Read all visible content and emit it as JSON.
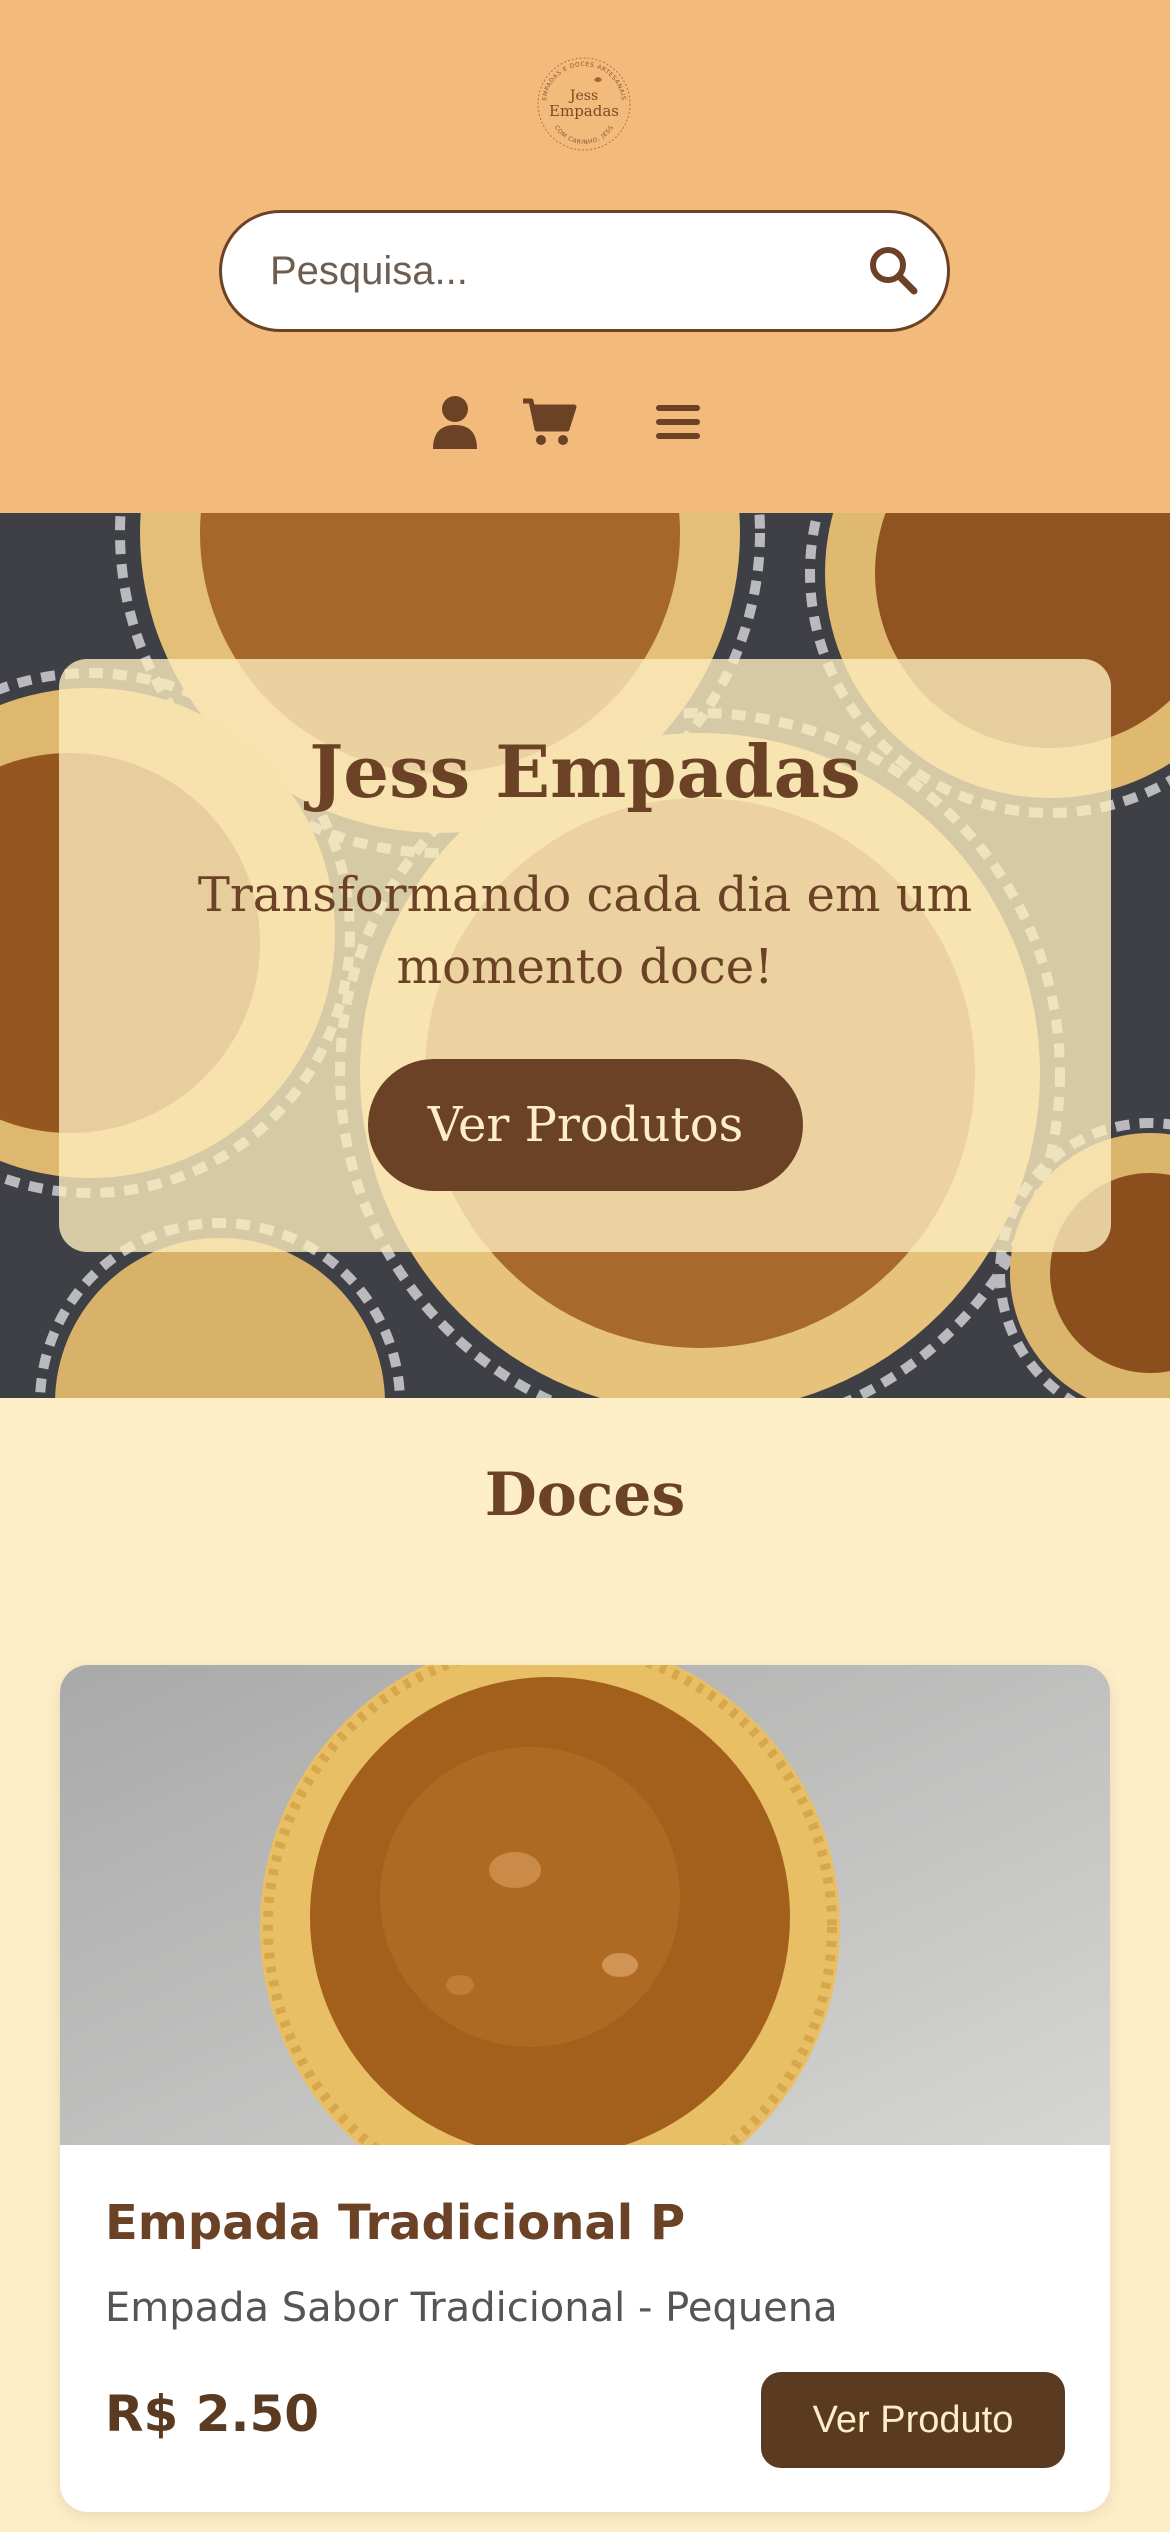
{
  "header": {
    "logo": {
      "name": "Jess Empadas",
      "line1": "Jess",
      "line2": "Empadas",
      "ring_top": "EMPADAS E DOCES ARTESANAIS",
      "ring_bottom": "COM CARINHO, JESS"
    },
    "search": {
      "placeholder": "Pesquisa..."
    },
    "icons": [
      "user-icon",
      "cart-icon",
      "menu-icon"
    ]
  },
  "hero": {
    "title": "Jess Empadas",
    "subtitle": "Transformando cada dia em um momento doce!",
    "button_label": "Ver Produtos"
  },
  "section": {
    "title": "Doces"
  },
  "products": [
    {
      "name": "Empada Tradicional P",
      "description": "Empada Sabor Tradicional - Pequena",
      "price": "R$ 2.50",
      "button_label": "Ver Produto"
    }
  ],
  "colors": {
    "header_bg": "#f2bb7b",
    "page_bg": "#fdeec8",
    "brown": "#6b4226",
    "card_bg": "#ffffff"
  }
}
